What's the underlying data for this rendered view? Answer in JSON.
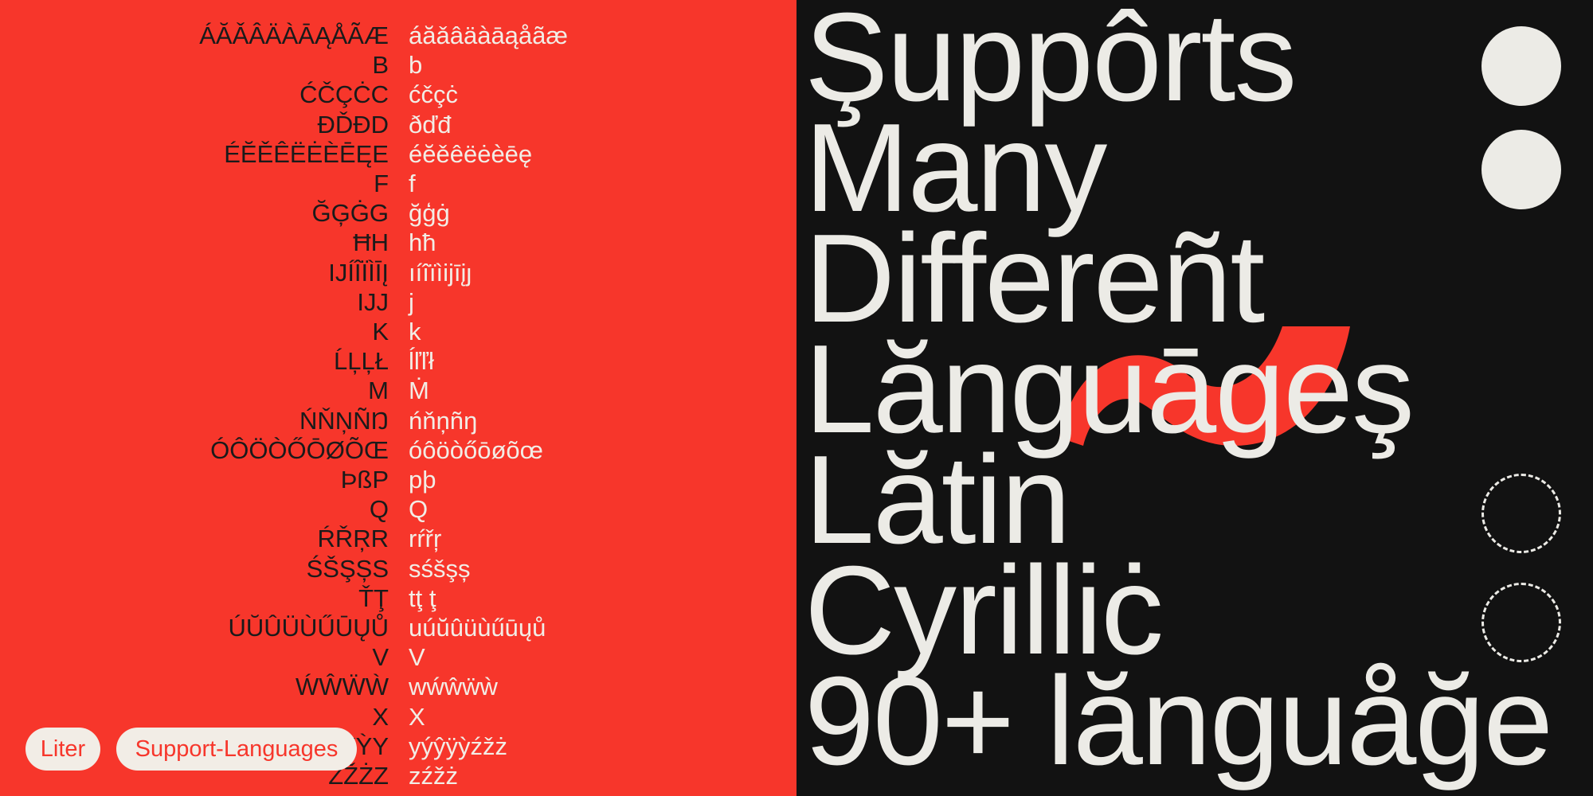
{
  "glyph_table": {
    "rows": [
      {
        "upper": "ÁĂǍÂÄÀĀĄÅÃÆ",
        "lower": "áăǎâäàāąåãæ"
      },
      {
        "upper": "B",
        "lower": "b"
      },
      {
        "upper": "ĆČÇĊC",
        "lower": "ćčçċ"
      },
      {
        "upper": "ĐĎĐD",
        "lower": "ðďđ"
      },
      {
        "upper": "ÉĔĚÊËĖÈĒĘE",
        "lower": "éĕěêëėèēę"
      },
      {
        "upper": "F",
        "lower": "f"
      },
      {
        "upper": "ĞĢĠG",
        "lower": "ğģġ"
      },
      {
        "upper": "ĦH",
        "lower": "hħ"
      },
      {
        "upper": "IJÍÎÏÌĪĮ",
        "lower": "ıíîïìijīįȷ"
      },
      {
        "upper": "IJJ",
        "lower": "j"
      },
      {
        "upper": "K",
        "lower": "k"
      },
      {
        "upper": "ĹĻĻŁ",
        "lower": "ĺľľł"
      },
      {
        "upper": "M",
        "lower": "Ṁ"
      },
      {
        "upper": "ŃŇŅÑŊ",
        "lower": "ńňņñŋ"
      },
      {
        "upper": "ÓÔÖÒŐŌØÕŒ",
        "lower": "óôöòőōøõœ"
      },
      {
        "upper": "ÞßP",
        "lower": "pþ"
      },
      {
        "upper": "Q",
        "lower": "Q"
      },
      {
        "upper": "ŔŘŖR",
        "lower": "rŕřŗ"
      },
      {
        "upper": "ŚŠŞȘS",
        "lower": "sśšşș"
      },
      {
        "upper": "ŤŢ",
        "lower": "tţ ţ"
      },
      {
        "upper": "ÚŬÛÜÙŰŪŲŮ",
        "lower": "uúŭûüùűūųů"
      },
      {
        "upper": "V",
        "lower": "V"
      },
      {
        "upper": "ẂŴẄẀ",
        "lower": "wẃŵẅẁ"
      },
      {
        "upper": "X",
        "lower": "X"
      },
      {
        "upper": "ÝŶŸỲY",
        "lower": "yýŷÿỳźžż"
      },
      {
        "upper": "ŹŽŻZ",
        "lower": "zźžż"
      }
    ]
  },
  "tags": [
    "Liter",
    "Support-Languages"
  ],
  "headline": [
    "Şuppôrts",
    "Many",
    "Differeñt",
    "Lănguāgeş",
    "Lătin",
    "Cyrilliċ",
    "90+ lănguåğe"
  ],
  "colors": {
    "red": "#f7362b",
    "dark": "#121212",
    "cream": "#ecebe6"
  }
}
